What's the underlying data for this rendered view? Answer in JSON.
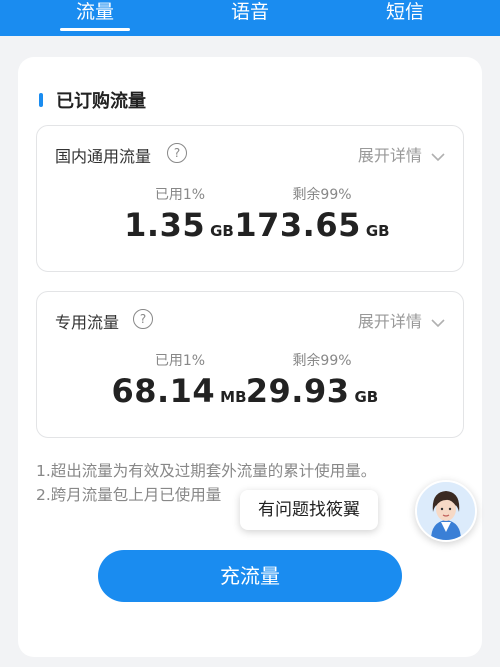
{
  "tabs": [
    {
      "label": "流量",
      "active": true
    },
    {
      "label": "语音",
      "active": false
    },
    {
      "label": "短信",
      "active": false
    }
  ],
  "section": {
    "title": "已订购流量"
  },
  "boxes": [
    {
      "title": "国内通用流量",
      "help": "?",
      "expand": "展开详情",
      "used": {
        "label": "已用1%",
        "value": "1.35",
        "unit": "GB"
      },
      "remain": {
        "label": "剩余99%",
        "value": "173.65",
        "unit": "GB"
      }
    },
    {
      "title": "专用流量",
      "help": "?",
      "expand": "展开详情",
      "used": {
        "label": "已用1%",
        "value": "68.14",
        "unit": "MB"
      },
      "remain": {
        "label": "剩余99%",
        "value": "29.93",
        "unit": "GB"
      }
    }
  ],
  "notes": [
    "1.超出流量为有效及过期套外流量的累计使用量。",
    "2.跨月流量包上月已使用量"
  ],
  "assistant": {
    "tooltip": "有问题找筱翼",
    "avatar_icon": "assistant-avatar-icon"
  },
  "cta": {
    "label": "充流量"
  },
  "colors": {
    "accent": "#1a8cf0",
    "background": "#f2f3f5"
  }
}
